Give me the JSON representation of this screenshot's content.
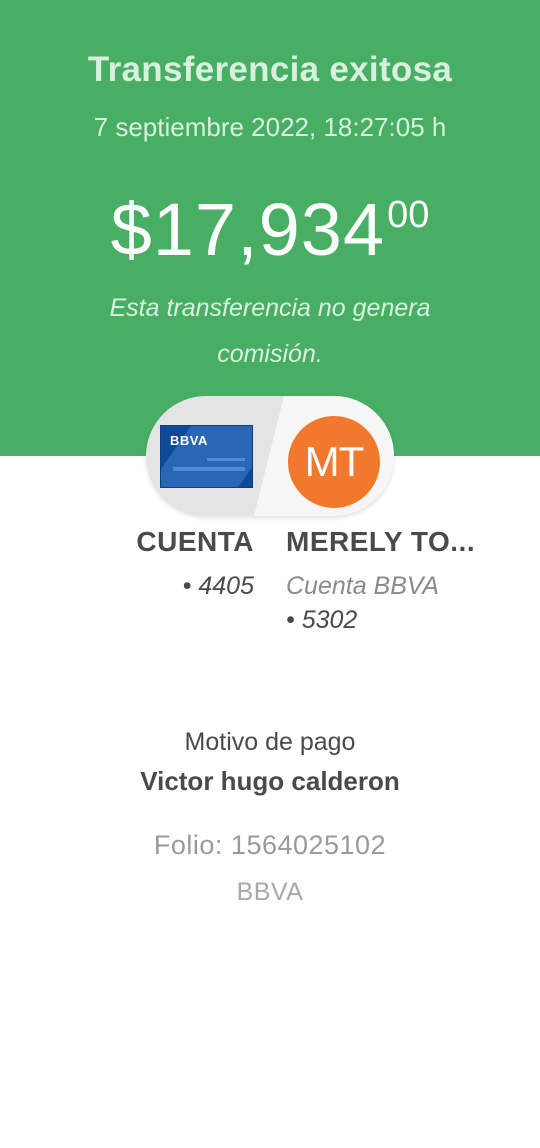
{
  "header": {
    "title": "Transferencia exitosa",
    "datetime": "7 septiembre 2022, 18:27:05 h",
    "amount": {
      "main": "$17,934",
      "cents": "00"
    },
    "fee_note": "Esta transferencia no genera comisión."
  },
  "transfer": {
    "origin": {
      "card_label": "BBVA",
      "name": "CUENTA",
      "account": "• 4405"
    },
    "destination": {
      "initials": "MT",
      "name": "MERELY TO...",
      "bank": "Cuenta BBVA",
      "account": "• 5302"
    }
  },
  "details": {
    "reason_label": "Motivo de pago",
    "reason_value": "Victor hugo calderon",
    "folio": "Folio: 1564025102",
    "bank": "BBVA"
  },
  "colors": {
    "header_green": "#48ae64",
    "avatar_orange": "#f0792e",
    "card_blue": "#0e4a9a"
  }
}
